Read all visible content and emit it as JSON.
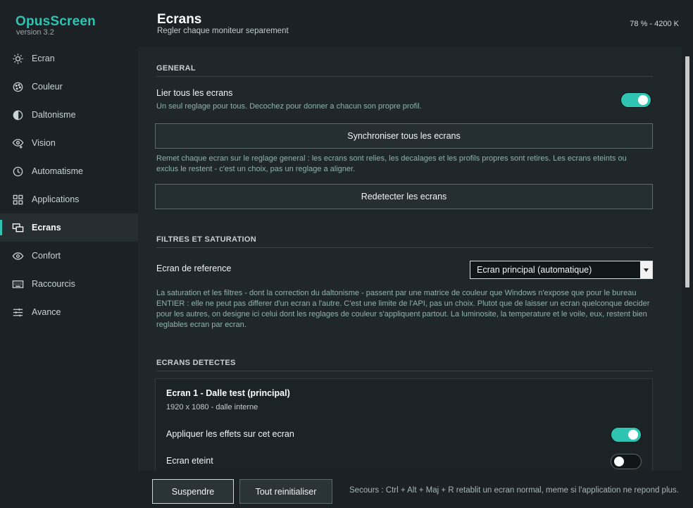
{
  "app": {
    "name": "OpusScreen",
    "version": "version 3.2"
  },
  "colors": {
    "accent": "#2ec4b1",
    "sidebar_bg": "#1b2124",
    "content_bg": "#20272a"
  },
  "sidebar": {
    "items": [
      {
        "label": "Ecran",
        "icon": "sun-icon",
        "active": false
      },
      {
        "label": "Couleur",
        "icon": "palette-icon",
        "active": false
      },
      {
        "label": "Daltonisme",
        "icon": "contrast-icon",
        "active": false
      },
      {
        "label": "Vision",
        "icon": "eye-plus-icon",
        "active": false
      },
      {
        "label": "Automatisme",
        "icon": "clock-icon",
        "active": false
      },
      {
        "label": "Applications",
        "icon": "grid-icon",
        "active": false
      },
      {
        "label": "Ecrans",
        "icon": "monitors-icon",
        "active": true
      },
      {
        "label": "Confort",
        "icon": "eye-icon",
        "active": false
      },
      {
        "label": "Raccourcis",
        "icon": "keyboard-icon",
        "active": false
      },
      {
        "label": "Avance",
        "icon": "sliders-icon",
        "active": false
      }
    ]
  },
  "header": {
    "title": "Ecrans",
    "subtitle": "Regler chaque moniteur separement",
    "status": "78 % - 4200 K"
  },
  "general": {
    "section_title": "GENERAL",
    "link_label": "Lier tous les ecrans",
    "link_desc": "Un seul reglage pour tous. Decochez pour donner a chacun son propre profil.",
    "link_enabled": true,
    "sync_button": "Synchroniser tous les ecrans",
    "sync_desc": "Remet chaque ecran sur le reglage general : les ecrans sont relies, les decalages et les profils propres sont retires. Les ecrans eteints ou exclus le restent - c'est un choix, pas un reglage a aligner.",
    "redetect_button": "Redetecter les ecrans"
  },
  "filters": {
    "section_title": "FILTRES ET SATURATION",
    "reference_label": "Ecran de reference",
    "reference_value": "Ecran principal (automatique)",
    "desc": "La saturation et les filtres - dont la correction du daltonisme - passent par une matrice de couleur que Windows n'expose que pour le bureau ENTIER : elle ne peut pas differer d'un ecran a l'autre. C'est une limite de l'API, pas un choix. Plutot que de laisser un ecran quelconque decider pour les autres, on designe ici celui dont les reglages de couleur s'appliquent partout. La luminosite, la temperature et le voile, eux, restent bien reglables ecran par ecran."
  },
  "detected": {
    "section_title": "ECRANS DETECTES",
    "screens": [
      {
        "title": "Ecran 1 - Dalle test (principal)",
        "details": "1920 x 1080  -  dalle interne",
        "apply_label": "Appliquer les effets sur cet ecran",
        "apply_enabled": true,
        "off_label": "Ecran eteint",
        "off_enabled": false
      }
    ]
  },
  "footer": {
    "suspend_button": "Suspendre",
    "reset_button": "Tout reinitialiser",
    "hint": "Secours : Ctrl + Alt + Maj + R retablit un ecran normal, meme si l'application ne repond plus."
  }
}
